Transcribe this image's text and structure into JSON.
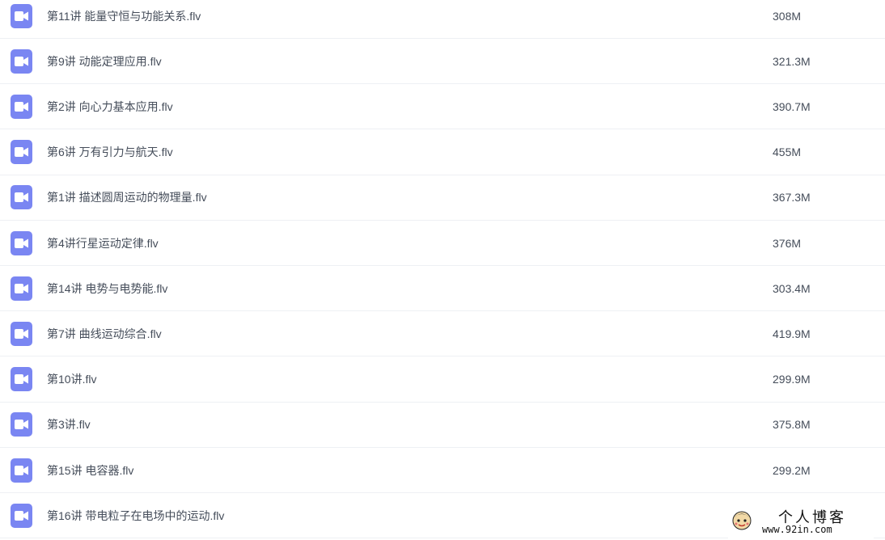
{
  "files": [
    {
      "name": "第11讲 能量守恒与功能关系.flv",
      "size": "308M",
      "icon": "video-file-icon"
    },
    {
      "name": "第9讲 动能定理应用.flv",
      "size": "321.3M",
      "icon": "video-file-icon"
    },
    {
      "name": "第2讲 向心力基本应用.flv",
      "size": "390.7M",
      "icon": "video-file-icon"
    },
    {
      "name": "第6讲 万有引力与航天.flv",
      "size": "455M",
      "icon": "video-file-icon"
    },
    {
      "name": "第1讲 描述圆周运动的物理量.flv",
      "size": "367.3M",
      "icon": "video-file-icon"
    },
    {
      "name": "第4讲行星运动定律.flv",
      "size": "376M",
      "icon": "video-file-icon"
    },
    {
      "name": "第14讲 电势与电势能.flv",
      "size": "303.4M",
      "icon": "video-file-icon"
    },
    {
      "name": "第7讲 曲线运动综合.flv",
      "size": "419.9M",
      "icon": "video-file-icon"
    },
    {
      "name": "第10讲.flv",
      "size": "299.9M",
      "icon": "video-file-icon"
    },
    {
      "name": "第3讲.flv",
      "size": "375.8M",
      "icon": "video-file-icon"
    },
    {
      "name": "第15讲 电容器.flv",
      "size": "299.2M",
      "icon": "video-file-icon"
    },
    {
      "name": "第16讲 带电粒子在电场中的运动.flv",
      "size": "",
      "icon": "video-file-icon"
    }
  ],
  "watermark": {
    "title": "个人博客",
    "url": "www.92in.com"
  },
  "colors": {
    "icon_bg": "#7a86f2",
    "text": "#454d5a",
    "divider": "#eef0f4"
  }
}
